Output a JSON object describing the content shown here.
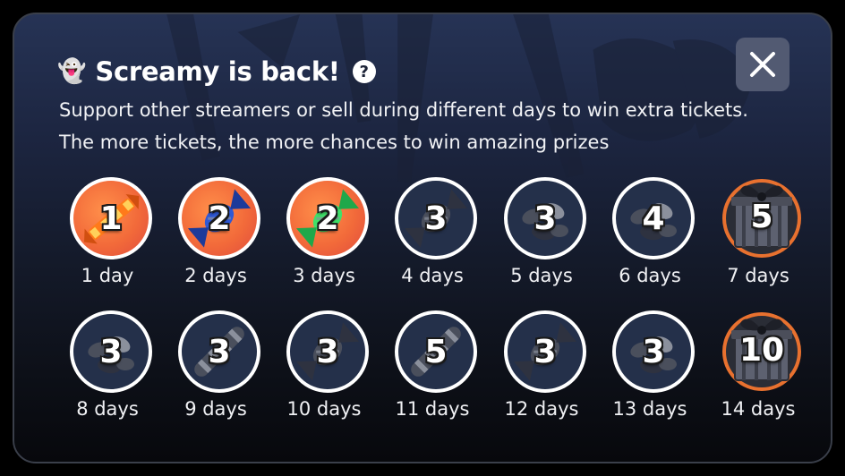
{
  "modal": {
    "title_emoji": "👻",
    "title": "Screamy is back!",
    "help_label": "?",
    "close_label": "✕",
    "description_line1": "Support other streamers or sell during different days to win extra tickets.",
    "description_line2": "The more tickets, the more chances to win amazing prizes"
  },
  "rewards": [
    {
      "tickets": "1",
      "label": "1 day",
      "icon": "orange-candy-icon",
      "state": "earned"
    },
    {
      "tickets": "2",
      "label": "2 days",
      "icon": "blue-candy-icon",
      "state": "earned"
    },
    {
      "tickets": "2",
      "label": "3 days",
      "icon": "green-candy-icon",
      "state": "earned"
    },
    {
      "tickets": "3",
      "label": "4 days",
      "icon": "candy-icon",
      "state": "locked"
    },
    {
      "tickets": "3",
      "label": "5 days",
      "icon": "jelly-beans-icon",
      "state": "locked"
    },
    {
      "tickets": "4",
      "label": "6 days",
      "icon": "jelly-beans-icon",
      "state": "locked"
    },
    {
      "tickets": "5",
      "label": "7 days",
      "icon": "gift-box-icon",
      "state": "locked"
    },
    {
      "tickets": "3",
      "label": "8 days",
      "icon": "jelly-beans-icon",
      "state": "locked"
    },
    {
      "tickets": "3",
      "label": "9 days",
      "icon": "candy-stick-icon",
      "state": "locked"
    },
    {
      "tickets": "3",
      "label": "10 days",
      "icon": "candy-icon",
      "state": "locked"
    },
    {
      "tickets": "5",
      "label": "11 days",
      "icon": "candy-stick-icon",
      "state": "locked"
    },
    {
      "tickets": "3",
      "label": "12 days",
      "icon": "candy-icon",
      "state": "locked"
    },
    {
      "tickets": "3",
      "label": "13 days",
      "icon": "jelly-beans-icon",
      "state": "locked"
    },
    {
      "tickets": "10",
      "label": "14 days",
      "icon": "gift-box-icon",
      "state": "locked"
    }
  ],
  "colors": {
    "earned_bg": "#f26a3a",
    "locked_bg": "#24304a",
    "close_bg": "#525a72",
    "gift_ring": "#e8712f"
  }
}
